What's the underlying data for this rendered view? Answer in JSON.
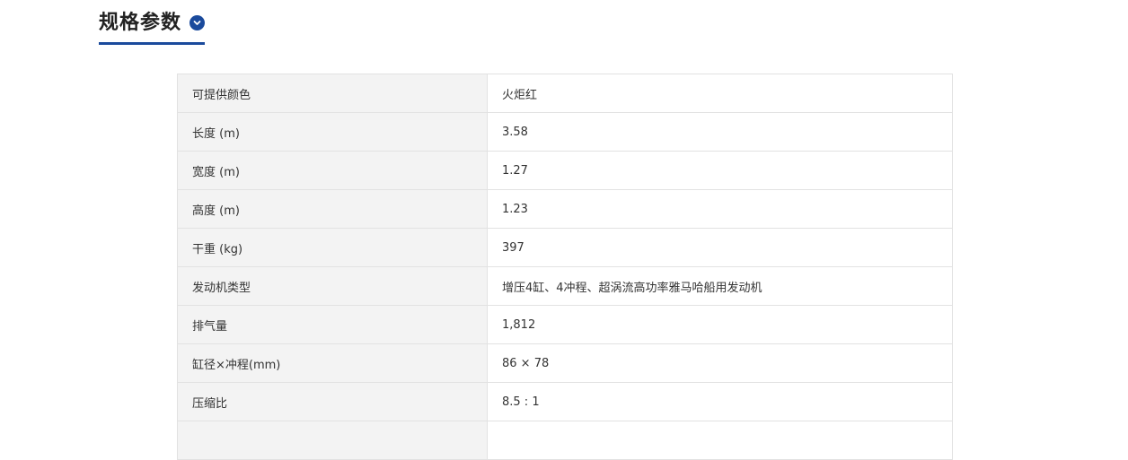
{
  "section": {
    "title": "规格参数",
    "toggle_icon": "chevron-down-icon",
    "accent_color": "#1a4a9c"
  },
  "specs": [
    {
      "label": "可提供颜色",
      "value": "火炬红"
    },
    {
      "label": "长度 (m)",
      "value": "3.58"
    },
    {
      "label": "宽度 (m)",
      "value": "1.27"
    },
    {
      "label": "高度 (m)",
      "value": "1.23"
    },
    {
      "label": "干重 (kg)",
      "value": "397"
    },
    {
      "label": "发动机类型",
      "value": "增压4缸、4冲程、超涡流高功率雅马哈船用发动机"
    },
    {
      "label": "排气量",
      "value": "1,812"
    },
    {
      "label": "缸径×冲程(mm)",
      "value": "86 × 78"
    },
    {
      "label": "压缩比",
      "value": "8.5 : 1"
    },
    {
      "label": "",
      "value": ""
    }
  ]
}
